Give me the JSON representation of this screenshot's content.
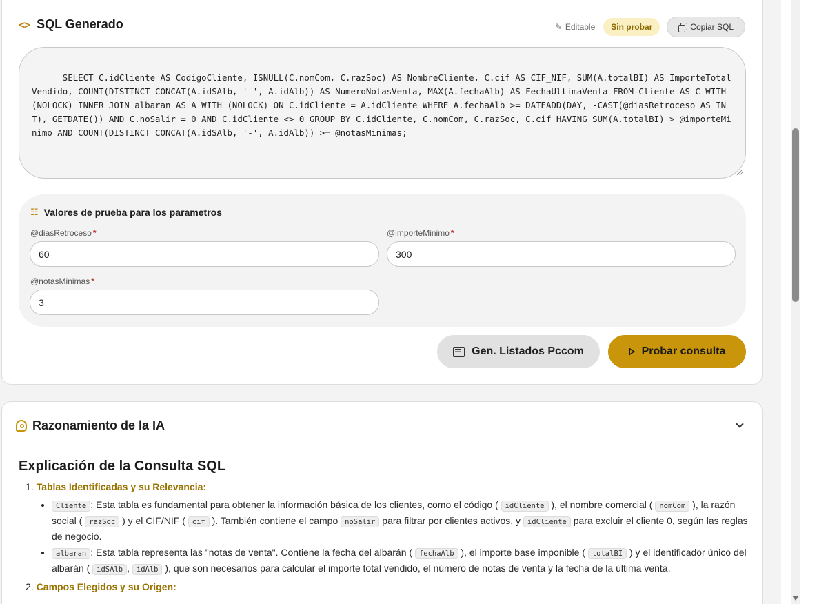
{
  "sql_card": {
    "icon": "code-icon",
    "title": "SQL Generado",
    "editable_label": "Editable",
    "status_badge": "Sin probar",
    "copy_button": "Copiar SQL",
    "sql_text": "SELECT C.idCliente AS CodigoCliente, ISNULL(C.nomCom, C.razSoc) AS NombreCliente, C.cif AS CIF_NIF, SUM(A.totalBI) AS ImporteTotalVendido, COUNT(DISTINCT CONCAT(A.idSAlb, '-', A.idAlb)) AS NumeroNotasVenta, MAX(A.fechaAlb) AS FechaUltimaVenta FROM Cliente AS C WITH (NOLOCK) INNER JOIN albaran AS A WITH (NOLOCK) ON C.idCliente = A.idCliente WHERE A.fechaAlb >= DATEADD(DAY, -CAST(@diasRetroceso AS INT), GETDATE()) AND C.noSalir = 0 AND C.idCliente <> 0 GROUP BY C.idCliente, C.nomCom, C.razSoc, C.cif HAVING SUM(A.totalBI) > @importeMinimo AND COUNT(DISTINCT CONCAT(A.idSAlb, '-', A.idAlb)) >= @notasMinimas;"
  },
  "params": {
    "title": "Valores de prueba para los parametros",
    "required_mark": "*",
    "fields": [
      {
        "label": "@diasRetroceso",
        "value": "60"
      },
      {
        "label": "@importeMinimo",
        "value": "300"
      },
      {
        "label": "@notasMinimas",
        "value": "3"
      }
    ]
  },
  "actions": {
    "listados_button": "Gen. Listados Pccom",
    "probar_button": "Probar consulta"
  },
  "ai_card": {
    "title": "Razonamiento de la IA",
    "heading": "Explicación de la Consulta SQL",
    "sections": [
      {
        "num": "1.",
        "title": "Tablas Identificadas y su Relevancia:",
        "bullets": [
          {
            "code": "Cliente",
            "t1": ": Esta tabla es fundamental para obtener la información básica de los clientes, como el código (",
            "c1": "idCliente",
            "t2": "), el nombre comercial (",
            "c2": "nomCom",
            "t3": "), la razón social (",
            "c3": "razSoc",
            "t4": ") y el CIF/NIF (",
            "c4": "cif",
            "t5": "). También contiene el campo",
            "c5": "noSalir",
            "t6": "para filtrar por clientes activos, y",
            "c6": "idCliente",
            "t7": "para excluir el cliente 0, según las reglas de negocio."
          },
          {
            "code": "albaran",
            "t1": ": Esta tabla representa las \"notas de venta\". Contiene la fecha del albarán (",
            "c1": "fechaAlb",
            "t2": "), el importe base imponible (",
            "c2": "totalBI",
            "t3": ") y el identificador único del albarán (",
            "c3": "idSAlb",
            "sep": ",",
            "c4": "idAlb",
            "t4": "), que son necesarios para calcular el importe total vendido, el número de notas de venta y la fecha de la última venta."
          }
        ]
      },
      {
        "num": "2.",
        "title": "Campos Elegidos y su Origen:"
      }
    ]
  },
  "colors": {
    "accent": "#c9950a",
    "accent_text": "#9a7400",
    "badge_bg": "#fbefc4"
  }
}
